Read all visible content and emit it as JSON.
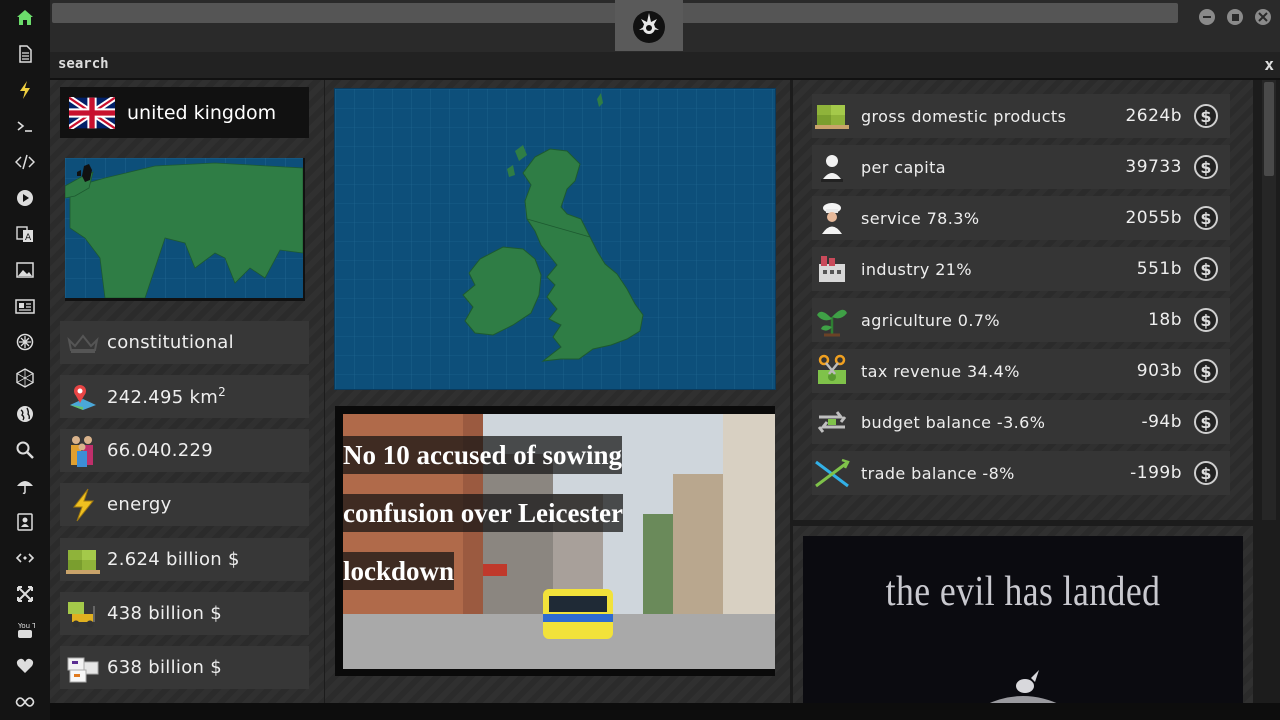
{
  "sidebar": {
    "icons": [
      "home-icon",
      "document-icon",
      "lightning-icon",
      "terminal-icon",
      "code-icon",
      "play-icon",
      "translate-icon",
      "image-icon",
      "newspaper-icon",
      "gear-icon",
      "hexagon-icon",
      "globe-icon",
      "search-icon",
      "umbrella-icon",
      "contacts-icon",
      "link-icon",
      "shuffle-icon",
      "youtube-icon",
      "heart-icon",
      "infinity-icon"
    ],
    "youtube_label": "You Tube",
    "active_color": "#6bdc6b"
  },
  "search": {
    "label": "search",
    "close": "x"
  },
  "country": {
    "name": "united kingdom",
    "government": "constitutional",
    "area_value": "242.495 km",
    "area_sup": "2",
    "population": "66.040.229",
    "energy_label": "energy",
    "gdp_total": "2.624 billion $",
    "debt": "438 billion $",
    "trade": "638 billion $"
  },
  "news": {
    "line1": "No 10 accused of sowing",
    "line2": "confusion over Leicester",
    "line3": "lockdown"
  },
  "economy": {
    "rows": [
      {
        "icon": "money-pallet-icon",
        "label": "gross domestic products",
        "value": "2624b"
      },
      {
        "icon": "person-icon",
        "label": "per capita",
        "value": "39733"
      },
      {
        "icon": "chef-icon",
        "label": "service 78.3%",
        "value": "2055b"
      },
      {
        "icon": "factory-icon",
        "label": "industry 21%",
        "value": "551b"
      },
      {
        "icon": "plant-icon",
        "label": "agriculture 0.7%",
        "value": "18b"
      },
      {
        "icon": "tax-scissors-icon",
        "label": "tax revenue 34.4%",
        "value": "903b"
      },
      {
        "icon": "balance-arrows-icon",
        "label": "budget balance -3.6%",
        "value": "-94b"
      },
      {
        "icon": "trade-cross-icon",
        "label": "trade balance -8%",
        "value": "-199b"
      }
    ],
    "currency_symbol": "$"
  },
  "promo": {
    "text": "the evil has landed"
  },
  "colors": {
    "map_sea": "#0d4f7a",
    "map_land": "#2f7d45",
    "panel": "#353535"
  }
}
